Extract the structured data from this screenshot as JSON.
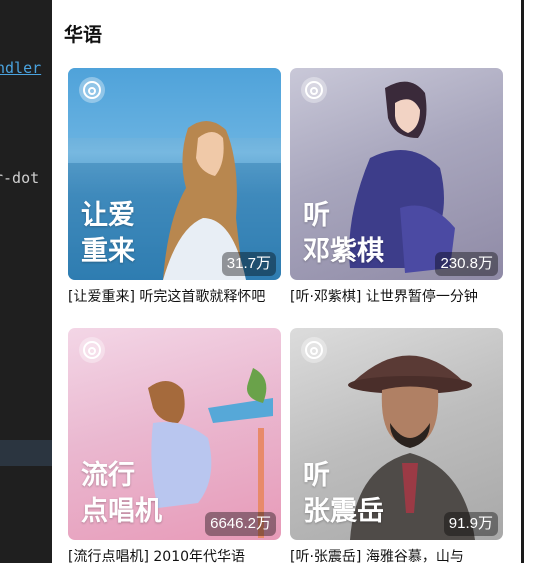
{
  "editor": {
    "line1": "ndler",
    "line2": "r-dot"
  },
  "section": {
    "title": "华语"
  },
  "playlists": [
    {
      "cover_title_line1": "让爱",
      "cover_title_line2": "重来",
      "play_count": "31.7万",
      "caption": "[让爱重来] 听完这首歌就释怀吧",
      "logo_icon": "netease-music-icon"
    },
    {
      "cover_title_line1": "听",
      "cover_title_line2": "邓紫棋",
      "play_count": "230.8万",
      "caption": "[听·邓紫棋] 让世界暂停一分钟",
      "logo_icon": "netease-music-icon"
    },
    {
      "cover_title_line1": "流行",
      "cover_title_line2": "点唱机",
      "play_count": "6646.2万",
      "caption": "[流行点唱机] 2010年代华语",
      "logo_icon": "netease-music-icon"
    },
    {
      "cover_title_line1": "听",
      "cover_title_line2": "张震岳",
      "play_count": "91.9万",
      "caption": "[听·张震岳] 海雅谷慕，山与",
      "logo_icon": "netease-music-icon"
    }
  ],
  "colors": {
    "accent": "#ffffff",
    "count_bg": "rgba(0,0,0,0.38)"
  }
}
